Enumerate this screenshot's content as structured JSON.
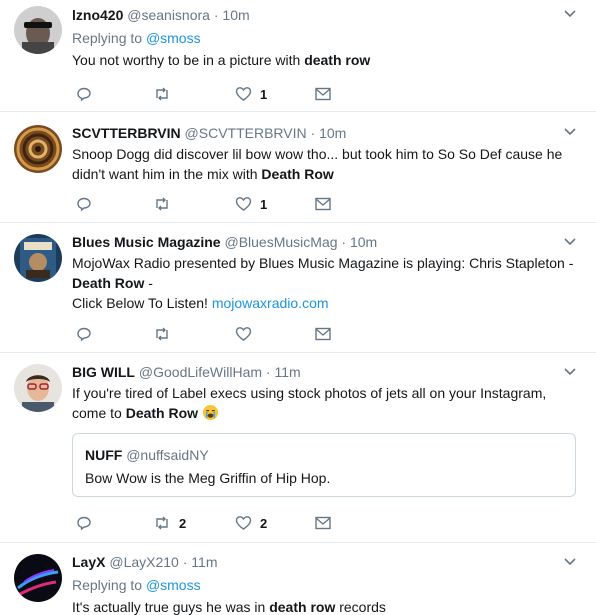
{
  "tweets": [
    {
      "name": "lzno420",
      "handle": "@seanisnora",
      "sep": "·",
      "time": "10m",
      "replying_to_label": "Replying to",
      "replying_to_handle": "@smoss",
      "text_before": "You not worthy to be in a picture with ",
      "text_bold": "death row",
      "likes": "1",
      "retweets": "",
      "replies": ""
    },
    {
      "name": "SCVTTERBRVIN",
      "handle": "@SCVTTERBRVIN",
      "sep": "·",
      "time": "10m",
      "text_before": "Snoop Dogg did discover lil bow wow tho... but took him to So So Def cause he didn't want him in the mix with ",
      "text_bold": "Death Row",
      "likes": "1",
      "retweets": "",
      "replies": ""
    },
    {
      "name": "Blues Music Magazine",
      "handle": "@BluesMusicMag",
      "sep": "·",
      "time": "10m",
      "text_before": "MojoWax Radio presented by Blues Music Magazine is playing: Chris Stapleton - ",
      "text_bold": "Death Row",
      "text_after": " -",
      "text_line2": "Click Below To Listen! ",
      "link": "mojowaxradio.com",
      "likes": "",
      "retweets": "",
      "replies": ""
    },
    {
      "name": "BIG WILL",
      "handle": "@GoodLifeWillHam",
      "sep": "·",
      "time": "11m",
      "text_before": "If you're tired of Label execs using stock photos of jets all on your Instagram, come to ",
      "text_bold": "Death Row",
      "quote": {
        "name": "NUFF",
        "handle": "@nuffsaidNY",
        "text": "Bow Wow is the Meg Griffin of Hip Hop."
      },
      "likes": "2",
      "retweets": "2",
      "replies": ""
    },
    {
      "name": "LayX",
      "handle": "@LayX210",
      "sep": "·",
      "time": "11m",
      "replying_to_label": "Replying to",
      "replying_to_handle": "@smoss",
      "text_before": "It's actually true guys he was in ",
      "text_bold": "death row",
      "text_after": " records"
    }
  ],
  "colors": {
    "text": "#14171a",
    "secondary": "#657786",
    "link": "#1b95e0",
    "divider": "#e6ecf0"
  },
  "icons": {
    "reply": "reply-icon",
    "retweet": "retweet-icon",
    "like": "heart-icon",
    "dm": "envelope-icon",
    "more": "chevron-down-icon",
    "emoji": "crying-face-emoji"
  }
}
